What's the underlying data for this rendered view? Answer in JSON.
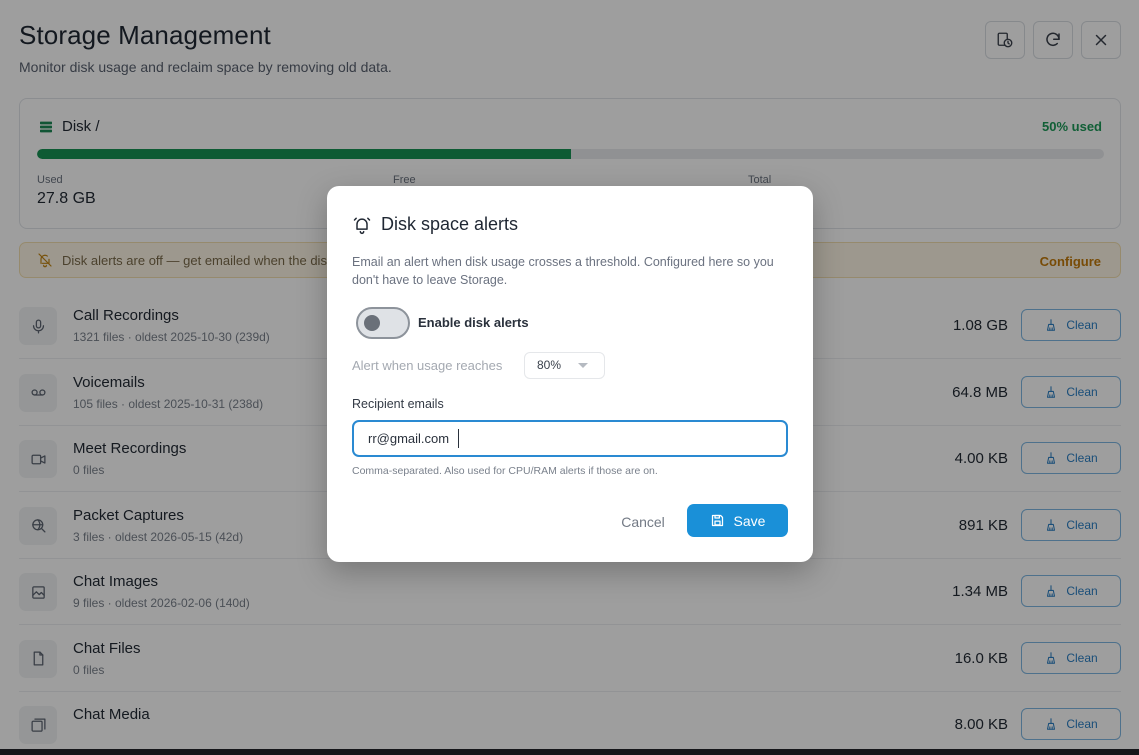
{
  "page": {
    "title": "Storage Management",
    "subtitle": "Monitor disk usage and reclaim space by removing old data."
  },
  "disk": {
    "label": "Disk /",
    "used_percent_label": "50% used",
    "used_fraction": 0.5,
    "stats": [
      {
        "key": "Used",
        "value": "27.8 GB"
      },
      {
        "key": "Free",
        "value": ""
      },
      {
        "key": "Total",
        "value": ""
      }
    ]
  },
  "alert_banner": {
    "text": "Disk alerts are off — get emailed when the disk",
    "action": "Configure"
  },
  "rows": [
    {
      "name": "Call Recordings",
      "meta": "1321 files  ·  oldest 2025-10-30 (239d)",
      "size": "1.08 GB",
      "icon": "microphone-icon"
    },
    {
      "name": "Voicemails",
      "meta": "105 files  ·  oldest 2025-10-31 (238d)",
      "size": "64.8 MB",
      "icon": "voicemail-icon"
    },
    {
      "name": "Meet Recordings",
      "meta": "0 files",
      "size": "4.00 KB",
      "icon": "video-camera-icon"
    },
    {
      "name": "Packet Captures",
      "meta": "3 files  ·  oldest 2026-05-15 (42d)",
      "size": "891 KB",
      "icon": "packet-search-icon"
    },
    {
      "name": "Chat Images",
      "meta": "9 files  ·  oldest 2026-02-06 (140d)",
      "size": "1.34 MB",
      "icon": "image-icon"
    },
    {
      "name": "Chat Files",
      "meta": "0 files",
      "size": "16.0 KB",
      "icon": "file-icon"
    },
    {
      "name": "Chat Media",
      "meta": "",
      "size": "8.00 KB",
      "icon": "media-icon"
    }
  ],
  "clean_label": "Clean",
  "modal": {
    "title": "Disk space alerts",
    "description": "Email an alert when disk usage crosses a threshold. Configured here so you don't have to leave Storage.",
    "toggle_label": "Enable disk alerts",
    "toggle_on": false,
    "threshold_label": "Alert when usage reaches",
    "threshold_value": "80%",
    "recipients_label": "Recipient emails",
    "recipients_value": "rr@gmail.com",
    "recipients_hint": "Comma-separated. Also used for CPU/RAM alerts if those are on.",
    "cancel_label": "Cancel",
    "save_label": "Save"
  },
  "colors": {
    "accent": "#1a90d8",
    "success": "#179455",
    "warning": "#c27a0a"
  }
}
